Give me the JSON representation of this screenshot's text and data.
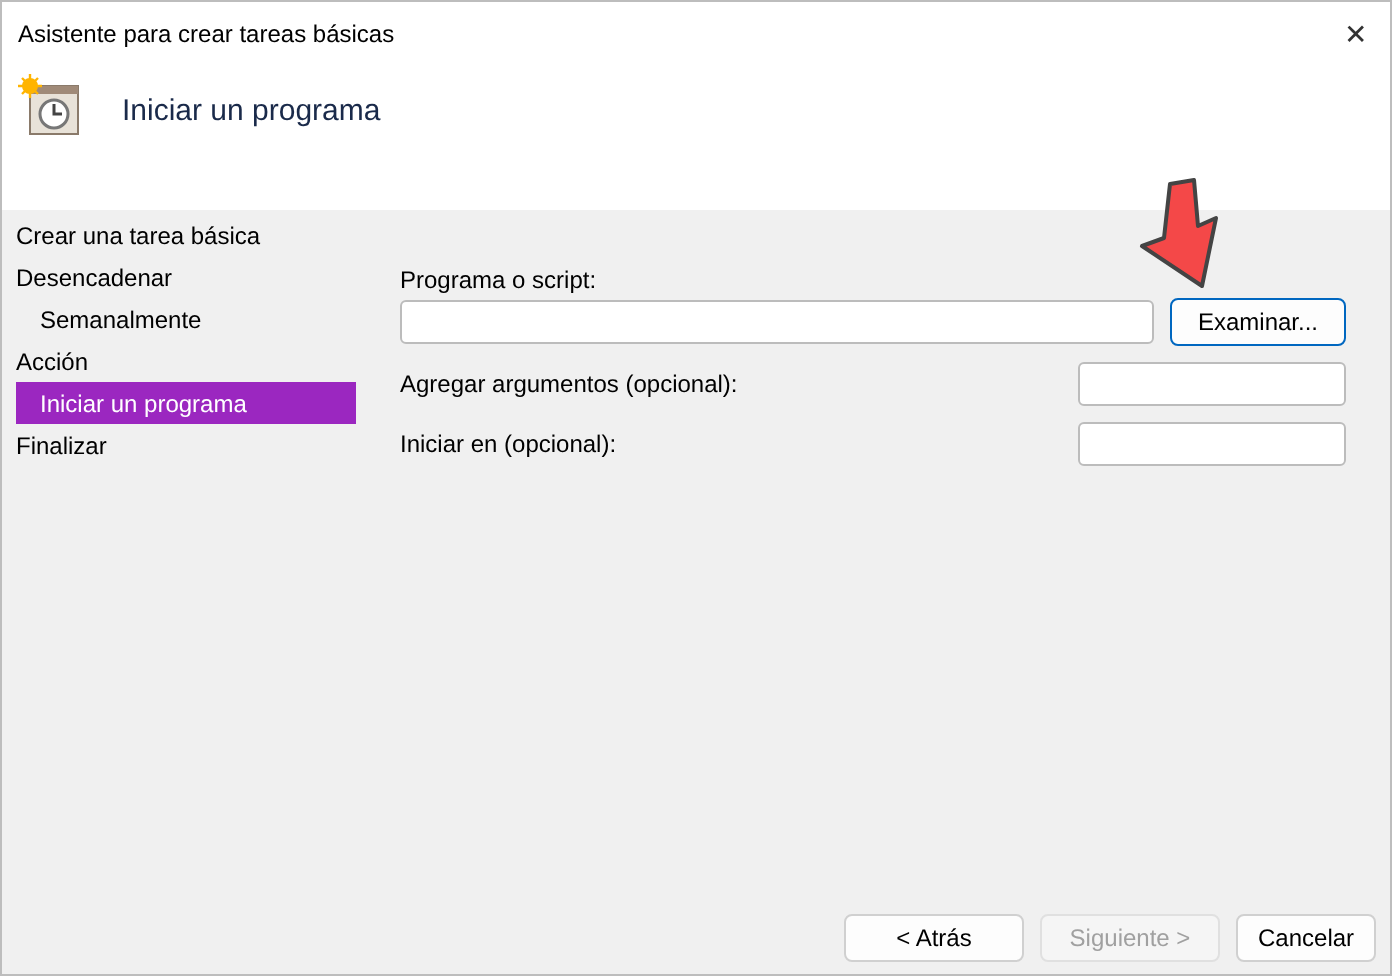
{
  "window": {
    "title": "Asistente para crear tareas básicas",
    "close": "✕"
  },
  "header": {
    "title": "Iniciar un programa"
  },
  "steps": [
    {
      "label": "Crear una tarea básica",
      "selected": false
    },
    {
      "label": "Desencadenar",
      "selected": false,
      "children": [
        {
          "label": "Semanalmente",
          "selected": false
        }
      ]
    },
    {
      "label": "Acción",
      "selected": false,
      "children": [
        {
          "label": "Iniciar un programa",
          "selected": true
        }
      ]
    },
    {
      "label": "Finalizar",
      "selected": false
    }
  ],
  "form": {
    "program_label": "Programa o script:",
    "browse_button": "Examinar...",
    "arguments_label": "Agregar argumentos (opcional):",
    "start_in_label": "Iniciar en (opcional):"
  },
  "buttons": [
    {
      "label": "< Atrás",
      "disabled": false
    },
    {
      "label": "Siguiente >",
      "disabled": true
    },
    {
      "label": "Cancelar",
      "disabled": false
    }
  ]
}
